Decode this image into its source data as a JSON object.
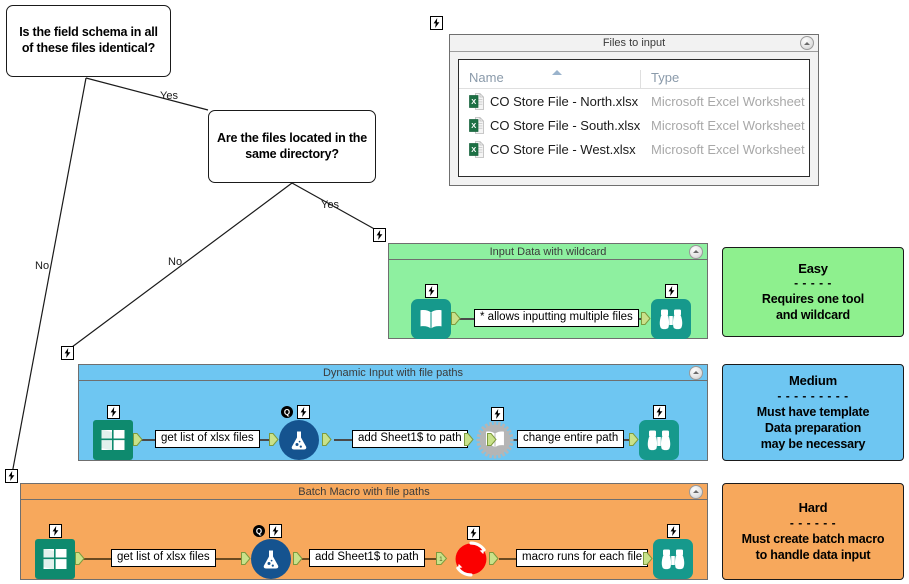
{
  "decisions": [
    {
      "id": "schema",
      "text": "Is the field schema in all of these files identical?"
    },
    {
      "id": "directory",
      "text": "Are the files located in the same directory?"
    }
  ],
  "edge_labels": {
    "schema_yes": "Yes",
    "schema_no": "No",
    "directory_yes": "Yes",
    "directory_no": "No"
  },
  "file_window": {
    "title": "Files to input",
    "collapse_icon": "chevron-up-icon",
    "columns": [
      "Name",
      "Type"
    ],
    "sort_indicator": "sort-ascending-caret",
    "rows": [
      {
        "icon": "excel-file-icon",
        "name": "CO Store File - North.xlsx",
        "type": "Microsoft Excel Worksheet"
      },
      {
        "icon": "excel-file-icon",
        "name": "CO Store File - South.xlsx",
        "type": "Microsoft Excel Worksheet"
      },
      {
        "icon": "excel-file-icon",
        "name": "CO Store File - West.xlsx",
        "type": "Microsoft Excel Worksheet"
      }
    ]
  },
  "panels": [
    {
      "id": "wildcard",
      "title": "Input Data with wildcard",
      "color": "#8ef0a0",
      "collapse_icon": "chevron-up-icon",
      "tools": [
        {
          "name": "input-data-tool",
          "icon": "open-book-icon"
        },
        {
          "name": "browse-tool",
          "icon": "binoculars-icon"
        }
      ],
      "annotations": [
        "* allows inputting multiple files"
      ]
    },
    {
      "id": "dynamic",
      "title": "Dynamic Input with file paths",
      "color": "#6ec6f2",
      "collapse_icon": "chevron-up-icon",
      "tools": [
        {
          "name": "directory-tool",
          "icon": "directory-book-icon"
        },
        {
          "name": "formula-tool",
          "icon": "flask-icon"
        },
        {
          "name": "dynamic-input-tool",
          "icon": "gear-book-icon"
        },
        {
          "name": "browse-tool",
          "icon": "binoculars-icon"
        }
      ],
      "annotations": [
        "get list of xlsx files",
        "add Sheet1$ to path",
        "change entire path"
      ]
    },
    {
      "id": "batch",
      "title": "Batch Macro with file paths",
      "color": "#f7a85c",
      "collapse_icon": "chevron-up-icon",
      "tools": [
        {
          "name": "directory-tool",
          "icon": "directory-book-icon"
        },
        {
          "name": "formula-tool",
          "icon": "flask-icon"
        },
        {
          "name": "batch-macro-tool",
          "icon": "red-circular-arrows-icon"
        },
        {
          "name": "browse-tool",
          "icon": "binoculars-icon"
        }
      ],
      "annotations": [
        "get list of xlsx files",
        "add Sheet1$ to path",
        "macro runs for each file"
      ]
    }
  ],
  "legend": [
    {
      "id": "easy",
      "title": "Easy",
      "rule": "- - - - -",
      "lines": [
        "Requires one tool",
        "and wildcard"
      ],
      "color": "#8ef08e"
    },
    {
      "id": "medium",
      "title": "Medium",
      "rule": "- - - - - - - - -",
      "lines": [
        "Must have template",
        "Data preparation",
        "may be necessary"
      ],
      "color": "#6ec6f2"
    },
    {
      "id": "hard",
      "title": "Hard",
      "rule": "- - - - - -",
      "lines": [
        "Must create batch macro",
        "to handle data input"
      ],
      "color": "#f7a85c"
    }
  ]
}
